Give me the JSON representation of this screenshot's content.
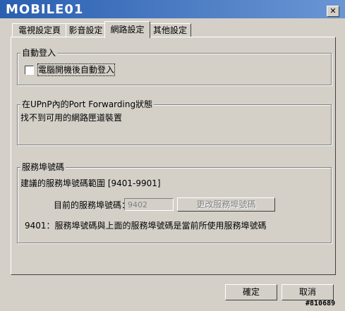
{
  "window": {
    "title": "MOBILE01",
    "close_label": "✕"
  },
  "tabs": [
    {
      "label": "電視設定頁"
    },
    {
      "label": "影音設定"
    },
    {
      "label": "網路設定"
    },
    {
      "label": "其他設定"
    }
  ],
  "auto_login": {
    "group_title": "自動登入",
    "checkbox_label": "電腦開機後自動登入",
    "checked": false
  },
  "upnp": {
    "group_title": "在UPnP內的Port Forwarding狀態",
    "status_text": "找不到可用的網路匣道裝置"
  },
  "service_port": {
    "group_title": "服務埠號碼",
    "suggested_range": "建議的服務埠號碼範圍 [9401-9901]",
    "current_label": "目前的服務埠號碼：",
    "current_value": "9402",
    "change_button": "更改服務埠號碼",
    "note": "9401：服務埠號碼與上面的服務埠號碼是當前所使用服務埠號碼"
  },
  "footer": {
    "ok_label": "確定",
    "cancel_label": "取消"
  },
  "watermark": "#810689"
}
